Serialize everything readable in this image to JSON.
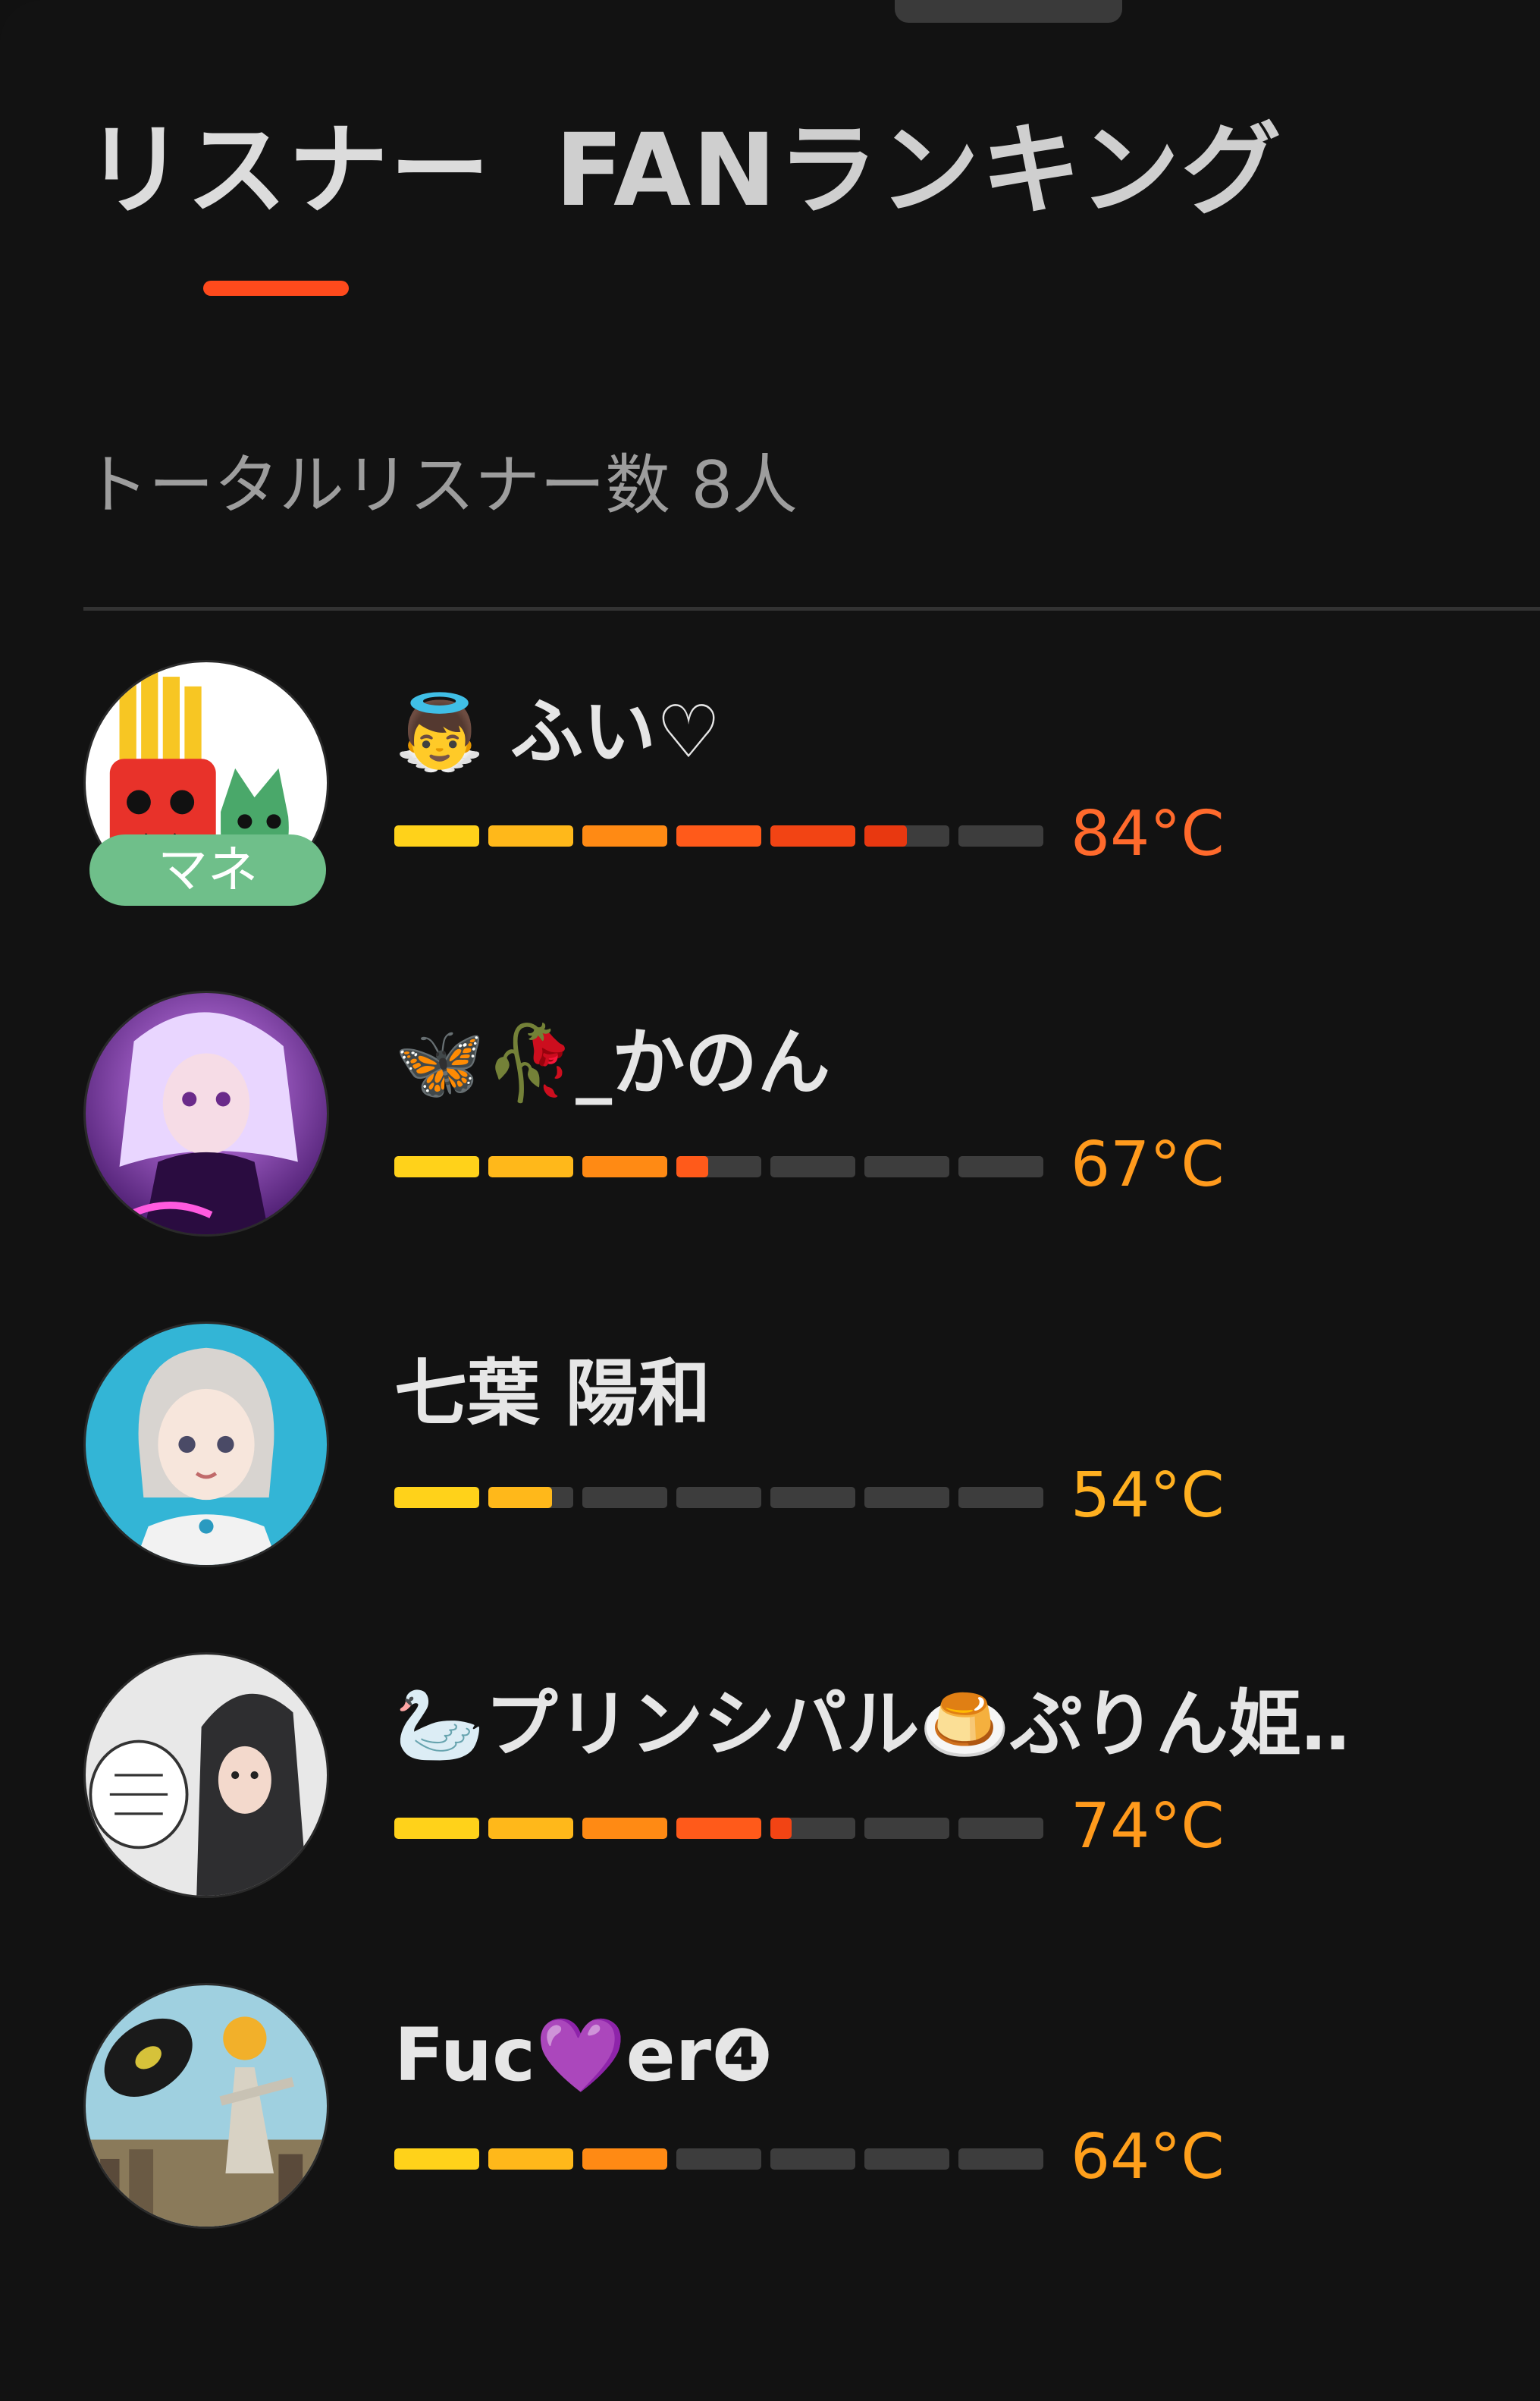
{
  "sheet": {
    "tabs": [
      {
        "label": "リスナー",
        "active": true
      },
      {
        "label": "FANランキング",
        "active": false
      }
    ],
    "total_label": "トータルリスナー数 8人"
  },
  "colors": {
    "background": "#121212",
    "accent": "#ff4a1c",
    "meter_empty": "#3d3d3d",
    "segment_colors": [
      "#ffd21a",
      "#ffb81a",
      "#ff8a14",
      "#ff5a1a",
      "#f24414",
      "#e83810",
      "#de300c"
    ],
    "badge": "#6fbf8a"
  },
  "listeners": [
    {
      "name": "👼 ふい♡",
      "temperature": 84,
      "temperature_label": "84°C",
      "temp_color": "#ff6a2c",
      "badge": "マネ",
      "avatar_icon": "fries-character-avatar"
    },
    {
      "name": "🦋🥀_かのん",
      "temperature": 67,
      "temperature_label": "67°C",
      "temp_color": "#ff9a1c",
      "badge": "",
      "avatar_icon": "anime-girl-purple-avatar"
    },
    {
      "name": "七葉 陽和",
      "temperature": 54,
      "temperature_label": "54°C",
      "temp_color": "#ffb020",
      "badge": "",
      "avatar_icon": "anime-girl-blue-avatar"
    },
    {
      "name": "🦢プリンシパル🍮ぷりん姫…",
      "temperature": 74,
      "temperature_label": "74°C",
      "temp_color": "#ff9a1c",
      "badge": "",
      "avatar_icon": "hooded-girl-avatar"
    },
    {
      "name": "Fuc💜er❹",
      "temperature": 64,
      "temperature_label": "64°C",
      "temp_color": "#ffa01c",
      "badge": "",
      "avatar_icon": "record-art-avatar"
    }
  ]
}
